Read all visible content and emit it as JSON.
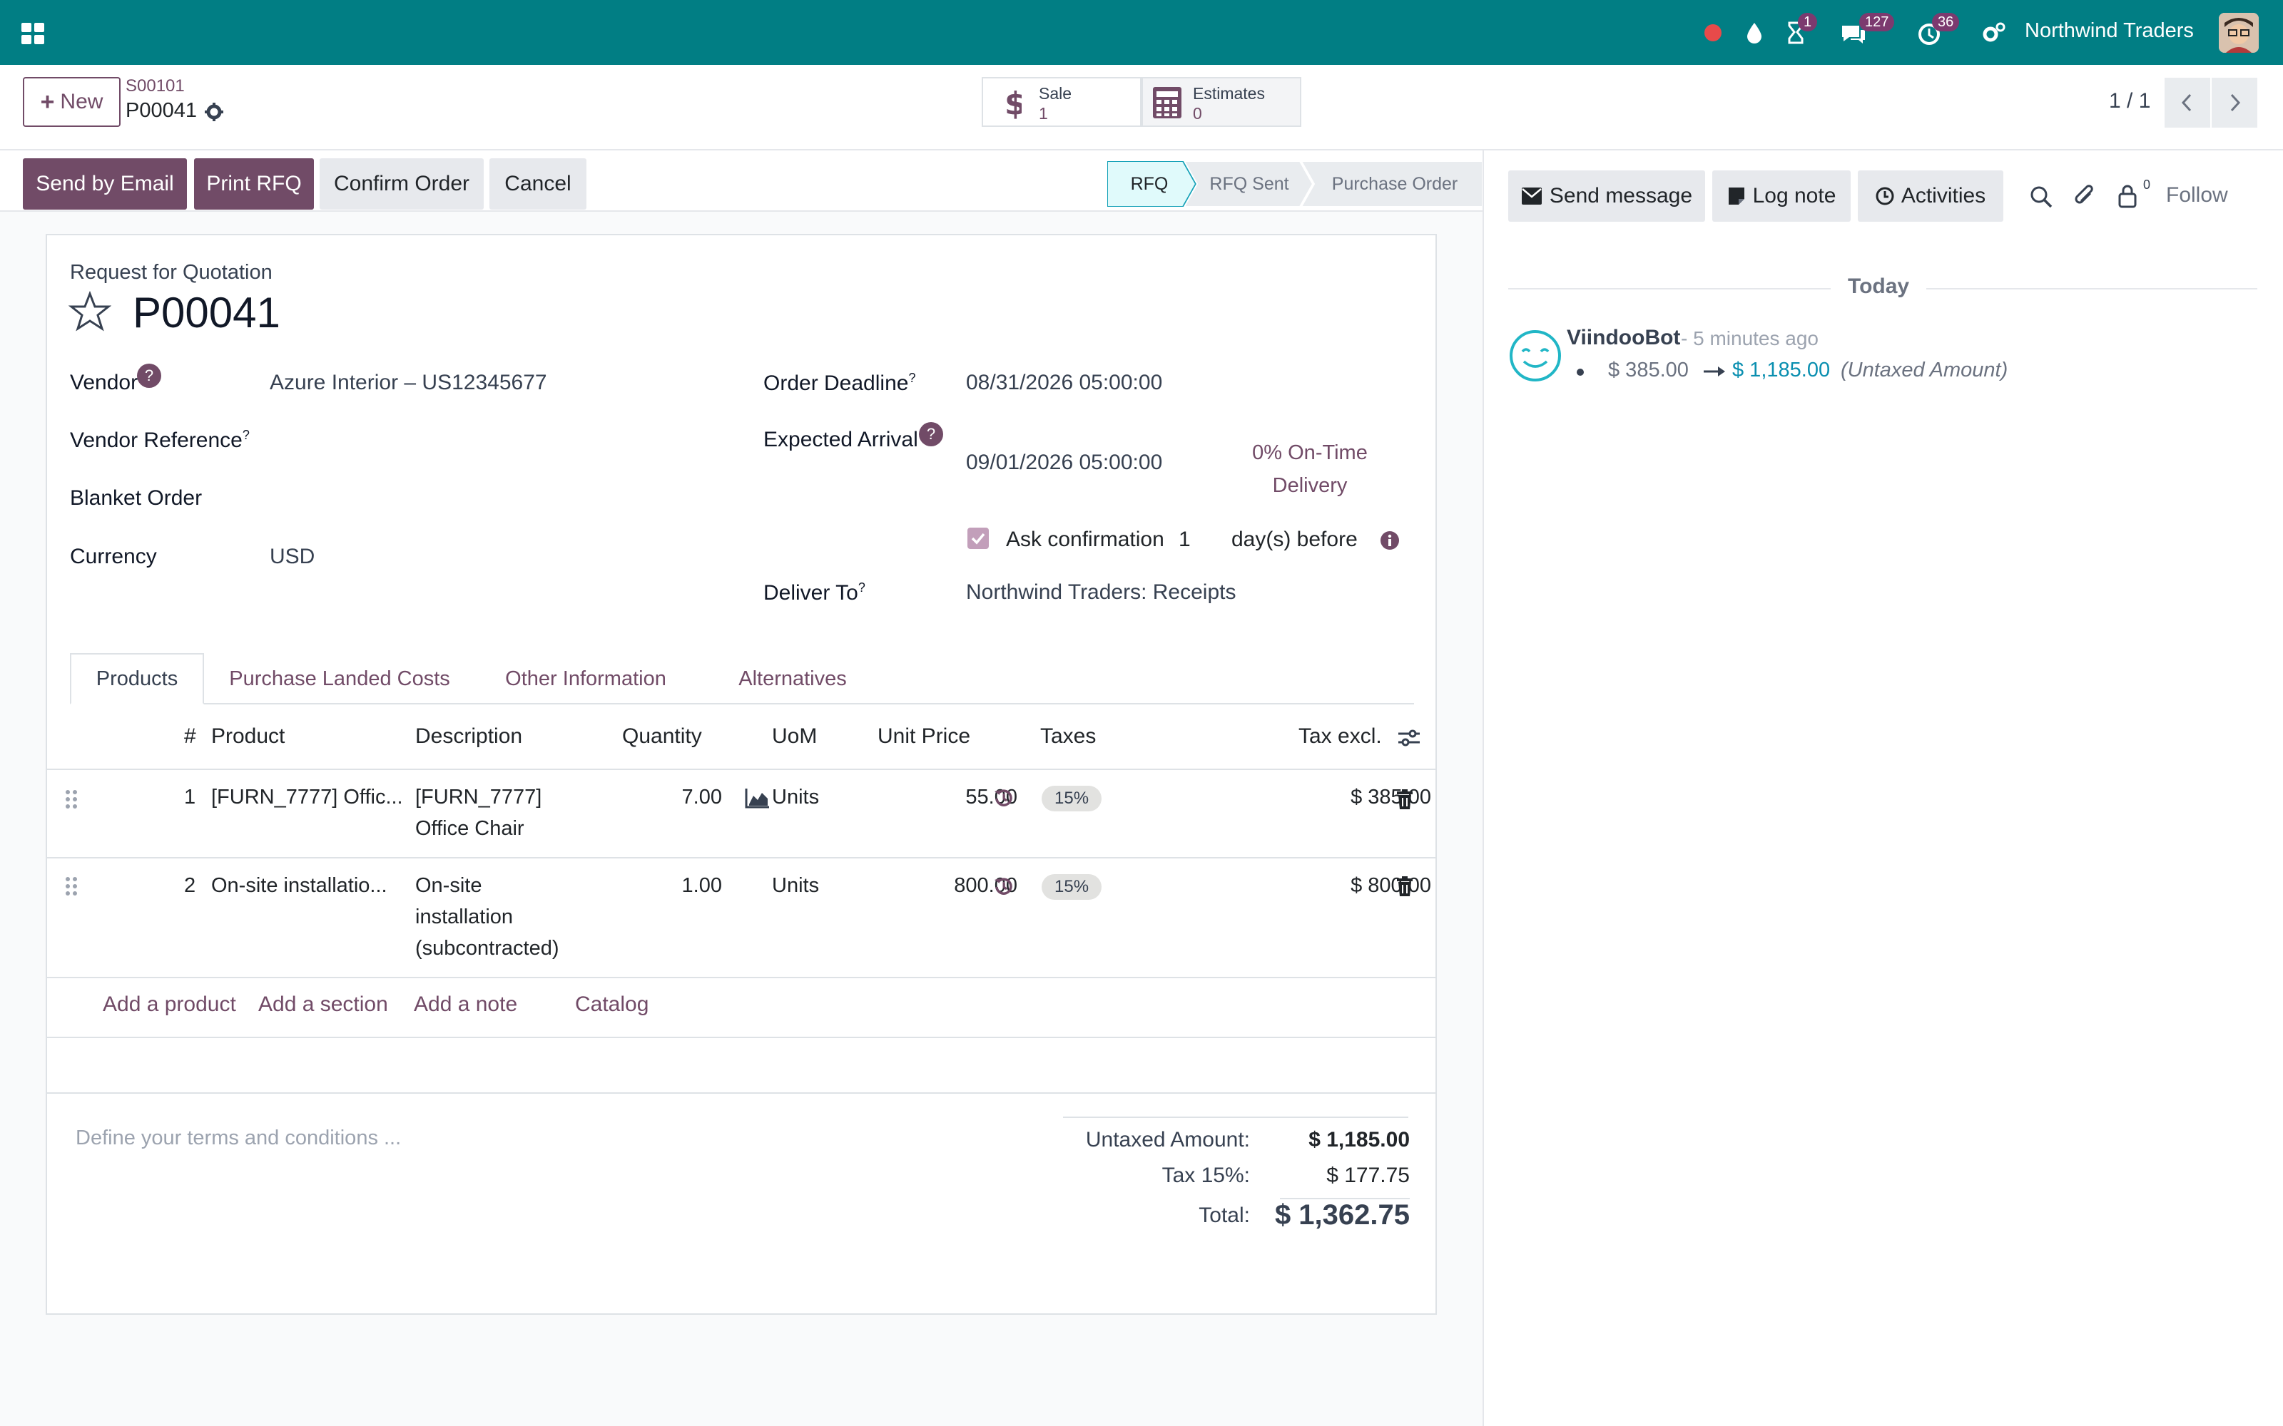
{
  "topbar": {
    "badges": {
      "activities": "1",
      "messages": "127",
      "timesheets": "36"
    },
    "company": "Northwind Traders"
  },
  "breadcrumb": {
    "parent": "S00101",
    "current": "P00041"
  },
  "buttons": {
    "new": "New"
  },
  "smart_buttons": [
    {
      "label": "Sale",
      "value": "1"
    },
    {
      "label": "Estimates",
      "value": "0"
    }
  ],
  "pager": {
    "value": "1 / 1"
  },
  "actions": {
    "send_email": "Send by Email",
    "print_rfq": "Print RFQ",
    "confirm": "Confirm Order",
    "cancel": "Cancel"
  },
  "statusbar": {
    "stages": [
      "RFQ",
      "RFQ Sent",
      "Purchase Order"
    ],
    "active": "RFQ"
  },
  "form": {
    "doc_type": "Request for Quotation",
    "name": "P00041",
    "vendor_label": "Vendor",
    "vendor": "Azure Interior – US12345677",
    "vendor_ref_label": "Vendor Reference",
    "blanket_label": "Blanket Order",
    "currency_label": "Currency",
    "currency": "USD",
    "deadline_label": "Order Deadline",
    "deadline": "08/31/2026 05:00:00",
    "arrival_label": "Expected Arrival",
    "arrival": "09/01/2026 05:00:00",
    "ontime_1": "0% On-Time",
    "ontime_2": "Delivery",
    "ask_label": "Ask confirmation",
    "ask_days": "1",
    "ask_suffix": "day(s) before",
    "deliver_label": "Deliver To",
    "deliver_to": "Northwind Traders: Receipts",
    "question_mark": "?"
  },
  "tabs": [
    "Products",
    "Purchase Landed Costs",
    "Other Information",
    "Alternatives"
  ],
  "table": {
    "headers": {
      "num": "#",
      "product": "Product",
      "description": "Description",
      "quantity": "Quantity",
      "uom": "UoM",
      "unit_price": "Unit Price",
      "taxes": "Taxes",
      "tax_excl": "Tax excl."
    },
    "rows": [
      {
        "num": "1",
        "product": "[FURN_7777] Offic...",
        "desc1": "[FURN_7777]",
        "desc2": "Office Chair",
        "desc3": "",
        "qty": "7.00",
        "uom": "Units",
        "price": "55.00",
        "tax": "15%",
        "subtotal": "$ 385.00"
      },
      {
        "num": "2",
        "product": "On-site installatio...",
        "desc1": "On-site",
        "desc2": "installation",
        "desc3": "(subcontracted)",
        "qty": "1.00",
        "uom": "Units",
        "price": "800.00",
        "tax": "15%",
        "subtotal": "$ 800.00"
      }
    ],
    "links": {
      "add_product": "Add a product",
      "add_section": "Add a section",
      "add_note": "Add a note",
      "catalog": "Catalog"
    }
  },
  "terms_placeholder": "Define your terms and conditions ...",
  "totals": {
    "untaxed_label": "Untaxed Amount:",
    "untaxed": "$ 1,185.00",
    "tax_label": "Tax 15%:",
    "tax": "$ 177.75",
    "total_label": "Total:",
    "total": "$ 1,362.75"
  },
  "chatter": {
    "send_message": "Send message",
    "log_note": "Log note",
    "activities": "Activities",
    "followers_count": "0",
    "follow": "Follow",
    "date_sep": "Today",
    "author": "ViindooBot",
    "time": "- 5 minutes ago",
    "old_value": "$ 385.00",
    "new_value": "$ 1,185.00",
    "field": "(Untaxed Amount)"
  },
  "colors": {
    "brand": "#017e84",
    "primary": "#714b67",
    "status_active": "#e0fafb"
  }
}
